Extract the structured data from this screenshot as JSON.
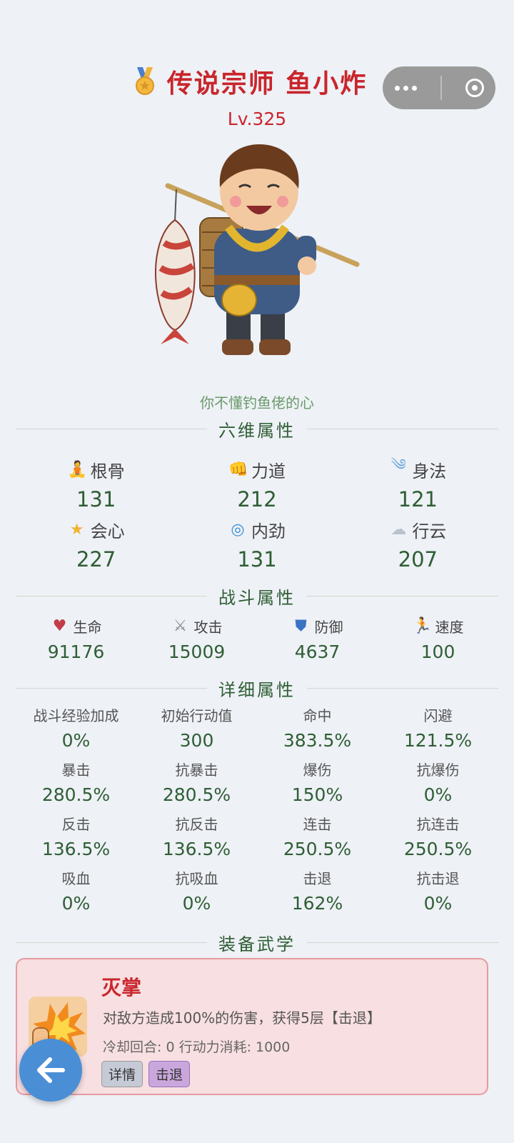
{
  "header": {
    "title": "传说宗师 鱼小炸",
    "level": "Lv.325"
  },
  "motto": "你不懂钓鱼佬的心",
  "sections": {
    "six": "六维属性",
    "combat": "战斗属性",
    "detail": "详细属性",
    "skill": "装备武学"
  },
  "six_attrs": [
    {
      "name": "根骨",
      "value": "131",
      "icon": "meditate-icon"
    },
    {
      "name": "力道",
      "value": "212",
      "icon": "fist-icon"
    },
    {
      "name": "身法",
      "value": "121",
      "icon": "wind-icon"
    },
    {
      "name": "会心",
      "value": "227",
      "icon": "star-icon"
    },
    {
      "name": "内劲",
      "value": "131",
      "icon": "swirl-icon"
    },
    {
      "name": "行云",
      "value": "207",
      "icon": "cloud-icon"
    }
  ],
  "combat_attrs": [
    {
      "name": "生命",
      "value": "91176",
      "icon": "heart-icon"
    },
    {
      "name": "攻击",
      "value": "15009",
      "icon": "swords-icon"
    },
    {
      "name": "防御",
      "value": "4637",
      "icon": "shield-icon"
    },
    {
      "name": "速度",
      "value": "100",
      "icon": "runner-icon"
    }
  ],
  "detail_attrs": [
    {
      "name": "战斗经验加成",
      "value": "0%"
    },
    {
      "name": "初始行动值",
      "value": "300"
    },
    {
      "name": "命中",
      "value": "383.5%"
    },
    {
      "name": "闪避",
      "value": "121.5%"
    },
    {
      "name": "暴击",
      "value": "280.5%"
    },
    {
      "name": "抗暴击",
      "value": "280.5%"
    },
    {
      "name": "爆伤",
      "value": "150%"
    },
    {
      "name": "抗爆伤",
      "value": "0%"
    },
    {
      "name": "反击",
      "value": "136.5%"
    },
    {
      "name": "抗反击",
      "value": "136.5%"
    },
    {
      "name": "连击",
      "value": "250.5%"
    },
    {
      "name": "抗连击",
      "value": "250.5%"
    },
    {
      "name": "吸血",
      "value": "0%"
    },
    {
      "name": "抗吸血",
      "value": "0%"
    },
    {
      "name": "击退",
      "value": "162%"
    },
    {
      "name": "抗击退",
      "value": "0%"
    }
  ],
  "skill": {
    "name": "灭掌",
    "desc": "对敌方造成100%的伤害，获得5层【击退】",
    "meta": "冷却回合: 0  行动力消耗: 1000",
    "tags": [
      "详情",
      "击退"
    ]
  },
  "colors": {
    "title_red": "#c8262c",
    "value_green": "#2f5e35",
    "card_bg": "#f8dfe1",
    "back_button": "#4a8fd6"
  }
}
